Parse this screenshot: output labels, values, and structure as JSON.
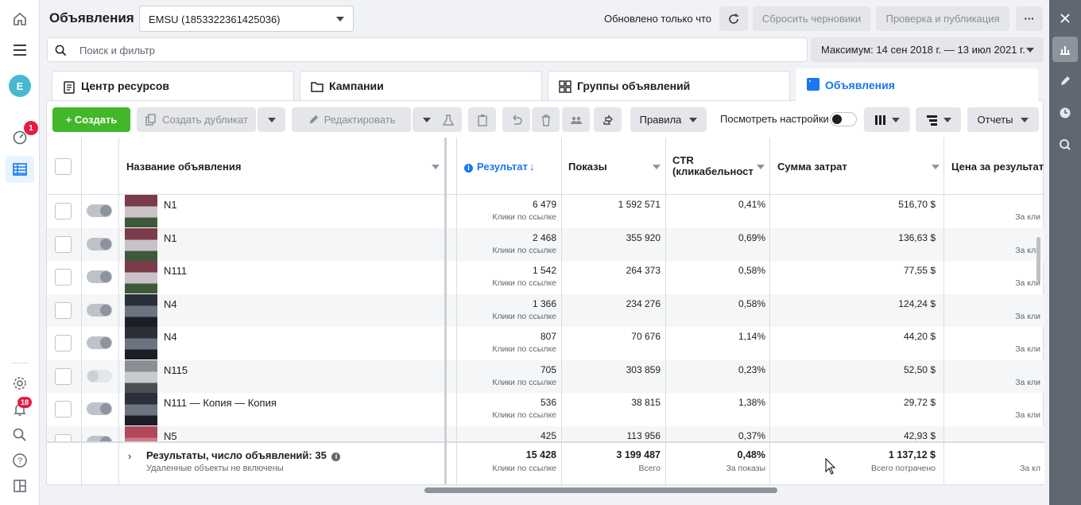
{
  "header": {
    "title": "Объявления",
    "account": "EMSU (1853322361425036)",
    "updated": "Обновлено только что",
    "reset_label": "Сбросить черновики",
    "publish_label": "Проверка и публикация",
    "more_label": "···"
  },
  "leftnav": {
    "avatar_letter": "E",
    "notif_badge": "1",
    "bell_badge": "18"
  },
  "search": {
    "placeholder": "Поиск и фильтр"
  },
  "daterange": {
    "label": "Максимум: 14 сен 2018 г. — 13 июл 2021 г."
  },
  "tabs": [
    {
      "label": "Центр ресурсов"
    },
    {
      "label": "Кампании"
    },
    {
      "label": "Группы объявлений"
    },
    {
      "label": "Объявления"
    }
  ],
  "toolbar": {
    "create_label": "+ Создать",
    "duplicate_label": "Создать дубликат",
    "edit_label": "Редактировать",
    "rules_label": "Правила",
    "view_settings_label": "Посмотреть настройки",
    "reports_label": "Отчеты"
  },
  "table": {
    "columns": {
      "name": "Название объявления",
      "result": "Результат",
      "impressions": "Показы",
      "ctr_line1": "CTR",
      "ctr_line2": "(кликабельност",
      "spend": "Сумма затрат",
      "cpr": "Цена за результат"
    },
    "rows": [
      {
        "name": "N1",
        "result": "6 479",
        "result_sub": "Клики по ссылке",
        "impressions": "1 592 571",
        "ctr": "0,41%",
        "spend": "516,70 $",
        "cpr_sub": "За кли",
        "active": true
      },
      {
        "name": "N1",
        "result": "2 468",
        "result_sub": "Клики по ссылке",
        "impressions": "355 920",
        "ctr": "0,69%",
        "spend": "136,63 $",
        "cpr_sub": "За кли",
        "active": true
      },
      {
        "name": "N111",
        "result": "1 542",
        "result_sub": "Клики по ссылке",
        "impressions": "264 373",
        "ctr": "0,58%",
        "spend": "77,55 $",
        "cpr_sub": "За кли",
        "active": true
      },
      {
        "name": "N4",
        "result": "1 366",
        "result_sub": "Клики по ссылке",
        "impressions": "234 276",
        "ctr": "0,58%",
        "spend": "124,24 $",
        "cpr_sub": "За кли",
        "active": true
      },
      {
        "name": "N4",
        "result": "807",
        "result_sub": "Клики по ссылке",
        "impressions": "70 676",
        "ctr": "1,14%",
        "spend": "44,20 $",
        "cpr_sub": "За кли",
        "active": true
      },
      {
        "name": "N115",
        "result": "705",
        "result_sub": "Клики по ссылке",
        "impressions": "303 859",
        "ctr": "0,23%",
        "spend": "52,50 $",
        "cpr_sub": "За кли",
        "active": false
      },
      {
        "name": "N111 — Копия — Копия",
        "result": "536",
        "result_sub": "Клики по ссылке",
        "impressions": "38 815",
        "ctr": "1,38%",
        "spend": "29,72 $",
        "cpr_sub": "За кли",
        "active": true
      },
      {
        "name": "N5",
        "result": "425",
        "result_sub": "",
        "impressions": "113 956",
        "ctr": "0,37%",
        "spend": "42,93 $",
        "cpr_sub": "",
        "active": true
      }
    ],
    "footer": {
      "label": "Результаты, число объявлений: 35",
      "sublabel": "Удаленные объекты не включены",
      "result": "15 428",
      "result_sub": "Клики по ссылке",
      "impressions": "3 199 487",
      "impressions_sub": "Всего",
      "ctr": "0,48%",
      "ctr_sub": "За показы",
      "spend": "1 137,12 $",
      "spend_sub": "Всего потрачено",
      "cpr_sub": "За кл"
    }
  }
}
